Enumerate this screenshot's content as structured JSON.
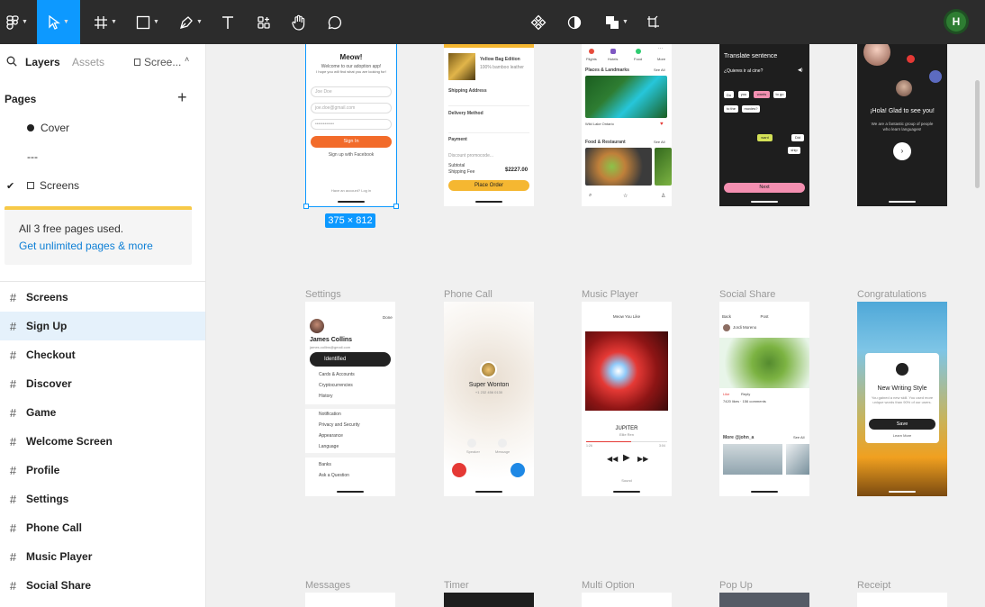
{
  "toolbar": {
    "colors": {
      "bg": "#2c2c2c",
      "active": "#0d99ff"
    },
    "user_initial": "H"
  },
  "sidebar": {
    "tabs": {
      "layers": "Layers",
      "assets": "Assets",
      "page_selector": "Scree..."
    },
    "pages_title": "Pages",
    "pages": [
      {
        "label": "Cover"
      },
      {
        "label": "---"
      },
      {
        "label": "Screens"
      }
    ],
    "upsell": {
      "text": "All 3 free pages used.",
      "link": "Get unlimited pages & more"
    },
    "layers": [
      {
        "label": "Screens"
      },
      {
        "label": "Sign Up"
      },
      {
        "label": "Checkout"
      },
      {
        "label": "Discover"
      },
      {
        "label": "Game"
      },
      {
        "label": "Welcome Screen"
      },
      {
        "label": "Profile"
      },
      {
        "label": "Settings"
      },
      {
        "label": "Phone Call"
      },
      {
        "label": "Music Player"
      },
      {
        "label": "Social Share"
      }
    ]
  },
  "canvas": {
    "selection_size": "375 × 812",
    "frame_labels": {
      "settings": "Settings",
      "phone_call": "Phone Call",
      "music_player": "Music Player",
      "social_share": "Social Share",
      "congratulations": "Congratulations",
      "messages": "Messages",
      "timer": "Timer",
      "multi_option": "Multi Option",
      "pop_up": "Pop Up",
      "receipt": "Receipt"
    },
    "signup": {
      "title": "Meow!",
      "subtitle": "Welcome to our adoption app!",
      "subtitle2": "I hope you will find what you are looking for!",
      "name_placeholder": "Joe Doe",
      "email_placeholder": "joe.doe@gmail.com",
      "password_placeholder": "••••••••••••",
      "sign_in": "Sign In",
      "facebook": "Sign up with Facebook",
      "footer": "Have an account? Log in"
    },
    "checkout": {
      "product": "Yellow Bag Edition",
      "product_sub": "100% bamboo leather",
      "shipping": "Shipping Address",
      "delivery": "Delivery Method",
      "payment": "Payment",
      "discount": "Discount promocode...",
      "subtotal": "Subtotal",
      "shipping_fee": "Shipping Fee",
      "total": "$2227.00",
      "order": "Place Order"
    },
    "discover": {
      "tabs": [
        "Flights",
        "Hotels",
        "Food",
        "More"
      ],
      "section1": "Places & Landmarks",
      "section2": "Food & Restaurant",
      "see_all": "See All",
      "place": "Wild Lake Ontario"
    },
    "game": {
      "heading": "Translate sentence",
      "question": "¿Quieres ir al cine?",
      "words": [
        "Do",
        "you",
        "wants",
        "to go",
        "to the",
        "movies?"
      ],
      "answer_words": [
        "want",
        "Did",
        "ship"
      ],
      "next": "Next"
    },
    "welcome": {
      "heading": "¡Hola! Glad to see you!",
      "sub": "We are a fantastic group of people who learn languages!"
    },
    "settings_screen": {
      "done": "Done",
      "name": "James Collins",
      "email": "james.collins@gmail.com",
      "identified": "Identified",
      "items": [
        "Cards & Accounts",
        "Cryptocurrencies",
        "History",
        "Notification",
        "Privacy and Security",
        "Appearance",
        "Language",
        "Banks",
        "Ask a Question"
      ]
    },
    "phone": {
      "name": "Super Wonton",
      "number": "+1 232 456 0130",
      "speaker": "Speaker",
      "message": "Message"
    },
    "music": {
      "header": "Meow You Like",
      "track": "JUPITER",
      "artist": "Ellie Ren",
      "time_start": "1:26",
      "time_end": "3:04",
      "sound": "Sound"
    },
    "social": {
      "back": "Back",
      "post": "Post",
      "author": "Jordi Moreno",
      "like": "Like",
      "reply": "Reply",
      "stats": "7420 likes · 156 comments",
      "more": "More @john_a",
      "see_all": "See All"
    },
    "congrats": {
      "title": "New Writing Style",
      "sub": "You gained a new skill. You used more unique words than 90% of our users.",
      "save": "Save",
      "learn": "Learn More"
    }
  }
}
